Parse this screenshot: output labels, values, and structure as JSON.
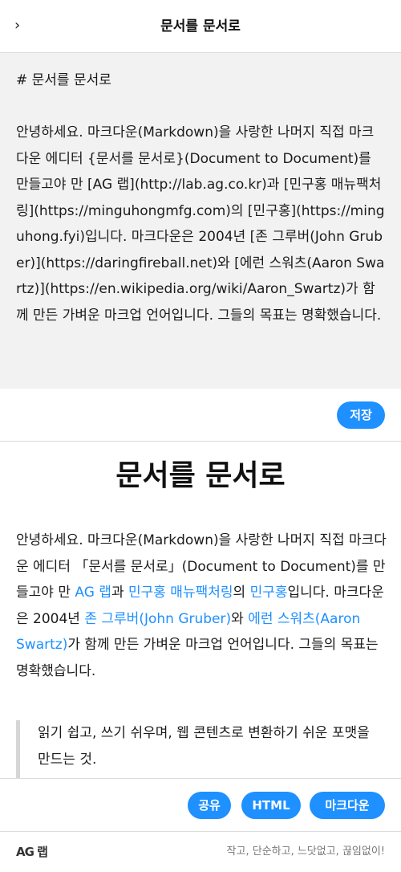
{
  "header": {
    "back_icon": "chevron-right-icon",
    "back_glyph": "›",
    "title": "문서를 문서로"
  },
  "editor": {
    "markdown": "# 문서를 문서로\n\n안녕하세요. 마크다운(Markdown)을 사랑한 나머지 직접 마크다운 에디터 {문서를 문서로}(Document to Document)를 만들고야 만 [AG 랩](http://lab.ag.co.kr)과 [민구홍 매뉴팩처링](https://minguhongmfg.com)의 [민구홍](https://minguhong.fyi)입니다. 마크다운은 2004년 [존 그루버(John Gruber)](https://daringfireball.net)와 [에런 스워츠(Aaron Swartz)](https://en.wikipedia.org/wiki/Aaron_Swartz)가 함께 만든 가벼운 마크업 언어입니다. 그들의 목표는 명확했습니다.",
    "save_label": "저장"
  },
  "preview": {
    "heading": "문서를 문서로",
    "para": {
      "t1": "안녕하세요. 마크다운(Markdown)을 사랑한 나머지 직접 마크다운 에디터 「문서를 문서로」(Document to Document)를 만들고야 만 ",
      "link1": "AG 랩",
      "t2": "과 ",
      "link2": "민구홍 매뉴팩처링",
      "t3": "의 ",
      "link3": "민구홍",
      "t4": "입니다. 마크다운은 2004년 ",
      "link4": "존 그루버(John Gruber)",
      "t5": "와 ",
      "link5": "에런 스워츠(Aaron Swartz)",
      "t6": "가 함께 만든 가벼운 마크업 언어입니다. 그들의 목표는 명확했습니다."
    },
    "quote": "읽기 쉽고, 쓰기 쉬우며, 웹 콘텐츠로 변환하기 쉬운 포맷을 만드는 것."
  },
  "actions": {
    "share_label": "공유",
    "html_label": "HTML",
    "markdown_label": "마크다운"
  },
  "footer": {
    "logo_text": "AG 랩",
    "slogan": "작고, 단순하고, 느닷없고, 끊임없이!"
  },
  "colors": {
    "accent": "#1e90ff",
    "editor_bg": "#f2f2f2",
    "divider": "#dcdcdc"
  }
}
